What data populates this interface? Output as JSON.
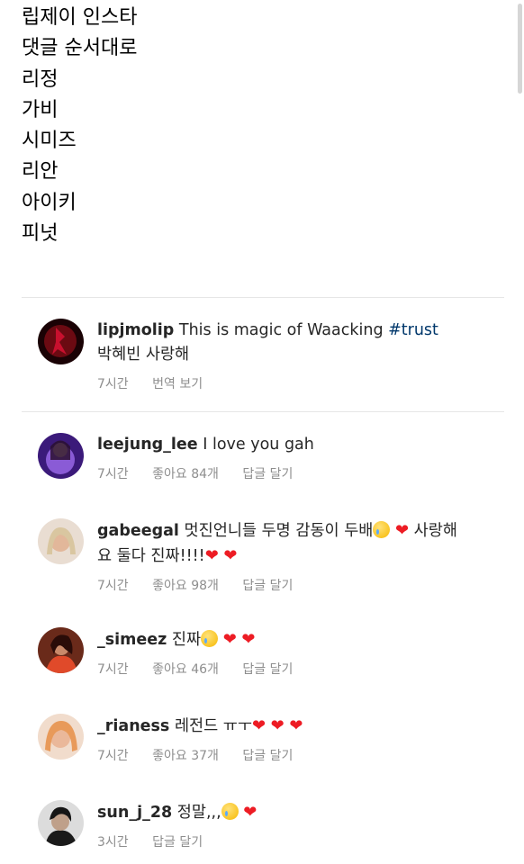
{
  "intro_lines": [
    "립제이 인스타",
    "댓글 순서대로",
    "리정",
    "가비",
    "시미즈",
    "리안",
    "아이키",
    "피넛"
  ],
  "comments": [
    {
      "username": "lipjmolip",
      "text": "This is magic of Waacking ",
      "hashtag": "#trust",
      "line2": "박혜빈 사랑해",
      "time": "7시간",
      "action1": "번역 보기"
    },
    {
      "username": "leejung_lee",
      "text": "I love you gah",
      "time": "7시간",
      "likes": "좋아요 84개",
      "reply": "답글 달기"
    },
    {
      "username": "gabeegal",
      "text": "멋진언니들 두명 감동이 두배",
      "text_after_emoji": "사랑해",
      "line2": "요 둘다 진짜!!!!",
      "time": "7시간",
      "likes": "좋아요 98개",
      "reply": "답글 달기"
    },
    {
      "username": "_simeez",
      "text": "진짜",
      "time": "7시간",
      "likes": "좋아요 46개",
      "reply": "답글 달기"
    },
    {
      "username": "_rianess",
      "text": "레전드 ㅠㅜ",
      "time": "7시간",
      "likes": "좋아요 37개",
      "reply": "답글 달기"
    },
    {
      "username": "sun_j_28",
      "text": "정말,,,",
      "time": "3시간",
      "reply": "답글 달기"
    }
  ],
  "emoji": {
    "heart": "❤",
    "crying": "crying-face-icon"
  },
  "colors": {
    "text": "#262626",
    "meta": "#8e8e8e",
    "hashtag": "#00376b",
    "heart": "#ed1c24",
    "divider": "#e6e6e6"
  }
}
